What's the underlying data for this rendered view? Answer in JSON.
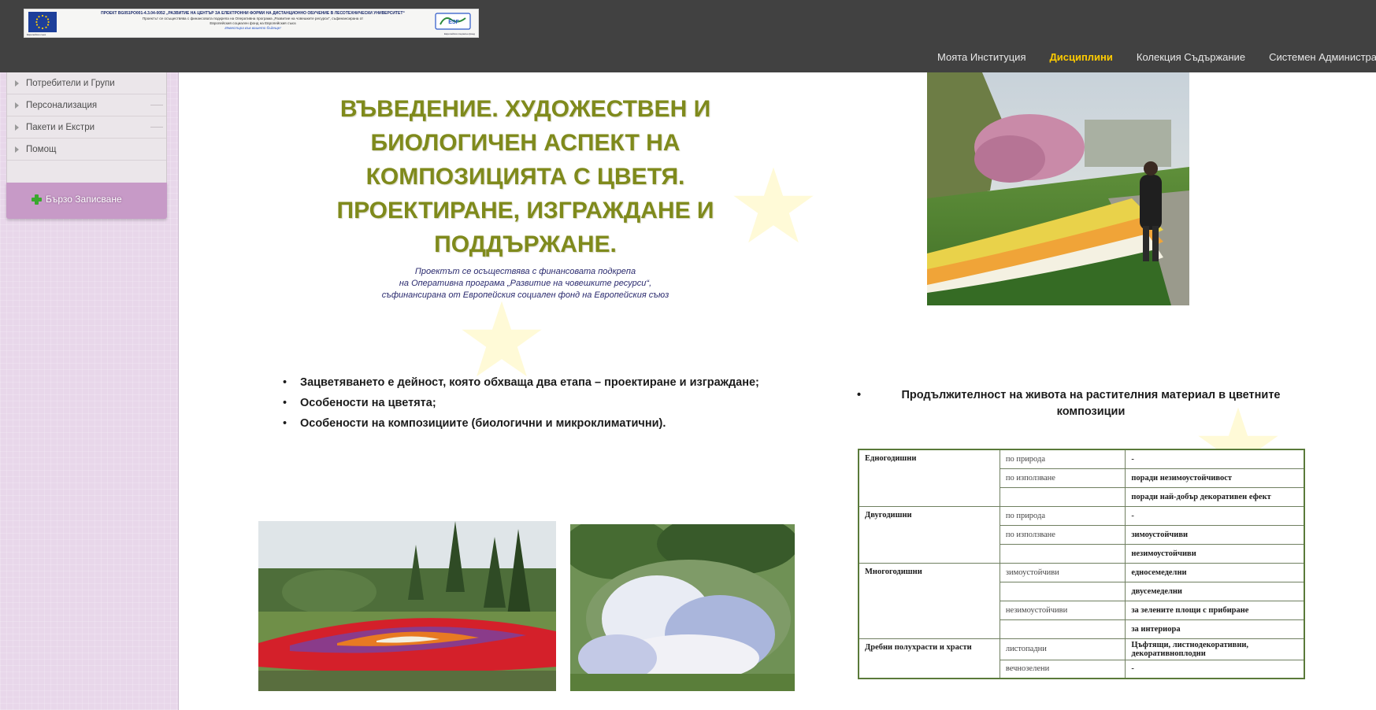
{
  "header": {
    "banner": {
      "line1": "ПРОЕКТ BG051PO001-4.3.04-0052 „РАЗВИТИЕ НА ЦЕНТЪР ЗА ЕЛЕКТРОННИ ФОРМИ НА ДИСТАНЦИОННО ОБУЧЕНИЕ В ЛЕСОТЕХНИЧЕСКИ УНИВЕРСИТЕТ“",
      "line2": "Проектът се осъществява с финансовата подкрепа на Оперативна програма „Развитие на човешките ресурси“, съфинансирана от",
      "line3": "Европейския социален фонд на Европейския съюз",
      "line4": "Инвестира във вашето бъдеще!",
      "eu_caption": "Европейски съюз",
      "esf_caption": "Европейски социален фонд",
      "eu_flag_color": "#1d3f9a",
      "star_color": "#ffcc00"
    },
    "nav": [
      {
        "label": "Моята Институция",
        "active": false
      },
      {
        "label": "Дисциплини",
        "active": true
      },
      {
        "label": "Колекция Съдържание",
        "active": false
      },
      {
        "label": "Системен Администратор",
        "active": false
      }
    ]
  },
  "sidebar": {
    "items": [
      {
        "label": "Потребители и Групи"
      },
      {
        "label": "Персонализация"
      },
      {
        "label": "Пакети и Екстри"
      },
      {
        "label": "Помощ"
      }
    ],
    "quick_button": "Бързо Записване"
  },
  "slide": {
    "title": "ВЪВЕДЕНИЕ. ХУДОЖЕСТВЕН И БИОЛОГИЧЕН АСПЕКТ НА КОМПОЗИЦИЯТА С ЦВЕТЯ. ПРОЕКТИРАНЕ, ИЗГРАЖДАНЕ И ПОДДЪРЖАНЕ.",
    "funding": [
      "Проектът се осъществява с финансовата подкрепа",
      "на Оперативна програма „Развитие на човешките ресурси“,",
      "съфинансирана от Европейския социален фонд на Европейския съюз"
    ],
    "bullets": [
      "Зацветяването е дейност, която обхваща два етапа – проектиране и изграждане;",
      "Особености на цветята;",
      "Особености на композициите (биологични и микроклиматични)."
    ],
    "lifespan_heading": "Продължителност на живота на растителния материал в цветните композиции",
    "table": [
      {
        "group": "Едногодишни",
        "rows": [
          {
            "sub": "по природа",
            "val": "-"
          },
          {
            "sub": "по използване",
            "val": "поради незимоустойчивост"
          },
          {
            "sub": "",
            "val": "поради най-добър декоративен ефект"
          }
        ]
      },
      {
        "group": "Двугодишни",
        "rows": [
          {
            "sub": "по природа",
            "val": "-"
          },
          {
            "sub": "по използване",
            "val": "зимоустойчиви"
          },
          {
            "sub": "",
            "val": "незимоустойчиви"
          }
        ]
      },
      {
        "group": "Многогодишни",
        "rows": [
          {
            "sub": "зимоустойчиви",
            "val": "едносемеделни"
          },
          {
            "sub": "",
            "val": "двусемеделни"
          },
          {
            "sub": "незимоустойчиви",
            "val": "за зелените площи с прибиране"
          },
          {
            "sub": "",
            "val": "за интериора"
          }
        ]
      },
      {
        "group": "Дребни полухрасти и храсти",
        "rows": [
          {
            "sub": "листопадни",
            "val": "Цъфтящи, листнодекоративни, декоративноплодни"
          },
          {
            "sub": "вечнозелени",
            "val": "-"
          }
        ]
      }
    ]
  },
  "theme": {
    "topbar": "#414141",
    "sidebar": "#e8d7ea",
    "quick_button": "#c79ac7",
    "title_color": "#7f8a1c",
    "active_nav": "#ffcc00",
    "table_border": "#5a7a3a"
  }
}
